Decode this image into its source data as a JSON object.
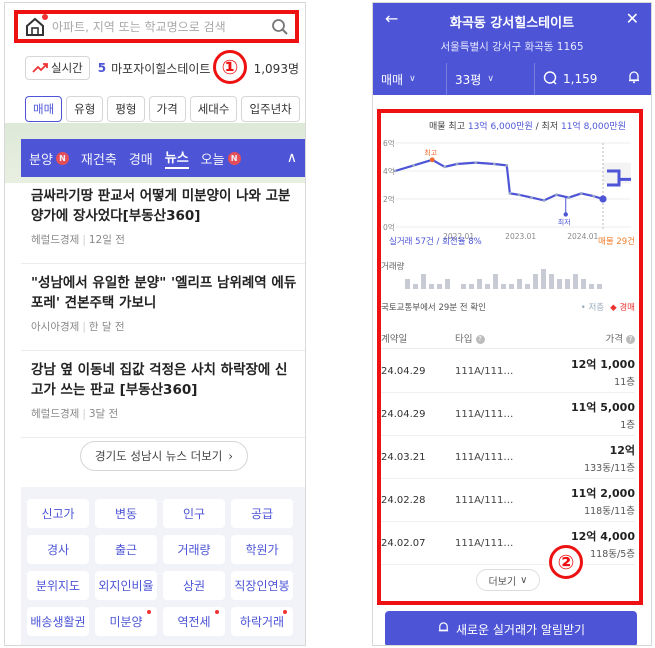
{
  "left": {
    "search": {
      "placeholder": "아파트, 지역 또는 학교명으로 검색"
    },
    "annotation_1": "①",
    "realtime": {
      "chip_label": "실시간",
      "rank": "5",
      "name": "마포자이힐스테이트",
      "count": "1,093명"
    },
    "filters": [
      "매매",
      "유형",
      "평형",
      "가격",
      "세대수",
      "입주년차"
    ],
    "news_tabs": [
      {
        "label": "분양",
        "badge": "N"
      },
      {
        "label": "재건축",
        "badge": ""
      },
      {
        "label": "경매",
        "badge": ""
      },
      {
        "label": "뉴스",
        "badge": ""
      },
      {
        "label": "오늘",
        "badge": "N"
      }
    ],
    "news": [
      {
        "title": "금싸라기땅 판교서 어떻게 미분양이 나와 고분양가에 장사었다[부동산360]",
        "source": "헤럴드경제",
        "time": "12일 전"
      },
      {
        "title": "\"성남에서 유일한 분양\" '엘리프 남위례역 에듀포레' 견본주택 가보니",
        "source": "아시아경제",
        "time": "한 달 전"
      },
      {
        "title": "강남 옆 이동네 집값 걱정은 사치 하락장에 신고가 쓰는 판교 [부동산360]",
        "source": "헤럴드경제",
        "time": "3달 전"
      }
    ],
    "news_more": "경기도 성남시 뉴스 더보기",
    "grid_buttons": [
      {
        "label": "신고가",
        "dot": false
      },
      {
        "label": "변동",
        "dot": false
      },
      {
        "label": "인구",
        "dot": false
      },
      {
        "label": "공급",
        "dot": false
      },
      {
        "label": "경사",
        "dot": false
      },
      {
        "label": "출근",
        "dot": false
      },
      {
        "label": "거래량",
        "dot": false
      },
      {
        "label": "학원가",
        "dot": false
      },
      {
        "label": "분위지도",
        "dot": false
      },
      {
        "label": "외지인비율",
        "dot": false
      },
      {
        "label": "상권",
        "dot": false
      },
      {
        "label": "직장인연봉",
        "dot": false
      },
      {
        "label": "배송생활권",
        "dot": false
      },
      {
        "label": "미분양",
        "dot": true
      },
      {
        "label": "역전세",
        "dot": true
      },
      {
        "label": "하락거래",
        "dot": true
      }
    ]
  },
  "right": {
    "title": "화곡동 강서힐스테이트",
    "address": "서울특별시 강서구 화곡동 1165",
    "bar": {
      "deal": "매매",
      "size": "33평",
      "comments": "1,159"
    },
    "summary": {
      "prefix": "매물 최고",
      "high": "13억 6,000만원",
      "mid": " / 최저",
      "low": "11억 8,000만원"
    },
    "annotation_2": "②",
    "chart_meta": {
      "left": "실거래 57건 / 회전율 8%",
      "right": "매물 29건"
    },
    "vol_label": "거래량",
    "source_note": "국토교통부에서 29분 전 확인",
    "legend": {
      "a": "• 저층",
      "b": "◆ 경매"
    },
    "table_head": {
      "date": "계약일",
      "type": "타입",
      "price": "가격"
    },
    "rows": [
      {
        "date": "24.04.29",
        "type": "111A/111…",
        "price": "12억 1,000",
        "floor": "11층"
      },
      {
        "date": "24.04.29",
        "type": "111A/111…",
        "price": "11억 5,000",
        "floor": "1층"
      },
      {
        "date": "24.03.21",
        "type": "111A/111…",
        "price": "12억",
        "floor": "133동/11층"
      },
      {
        "date": "24.02.28",
        "type": "111A/111…",
        "price": "11억 2,000",
        "floor": "118동/11층"
      },
      {
        "date": "24.02.07",
        "type": "111A/111…",
        "price": "12억 4,000",
        "floor": "118동/5층"
      }
    ],
    "more": "더보기",
    "alert": "새로운 실거래가 알림받기"
  },
  "chart_data": {
    "type": "line",
    "y_ticks": [
      "6억",
      "4억",
      "2억",
      "0억"
    ],
    "x_ticks": [
      "2022.01",
      "2023.01",
      "2024.01"
    ],
    "ylim": [
      0,
      6
    ],
    "annotations": [
      "최고",
      "최저"
    ],
    "series": [
      {
        "x": [
          2021.0,
          2021.3,
          2021.6,
          2021.8,
          2022.0,
          2022.3,
          2022.6,
          2022.8,
          2022.85,
          2023.0,
          2023.2,
          2023.4,
          2023.6,
          2023.8,
          2024.0,
          2024.2,
          2024.35
        ],
        "values": [
          4.0,
          4.4,
          4.8,
          4.3,
          4.5,
          4.6,
          4.5,
          4.4,
          2.4,
          2.3,
          2.1,
          1.9,
          2.3,
          2.1,
          2.4,
          2.2,
          2.0
        ]
      }
    ],
    "volume": [
      2,
      1,
      3,
      1,
      1,
      2,
      0,
      1,
      1,
      2,
      1,
      3,
      1,
      1,
      2,
      1,
      3,
      4,
      3,
      2,
      2,
      3,
      2,
      1,
      1
    ]
  }
}
